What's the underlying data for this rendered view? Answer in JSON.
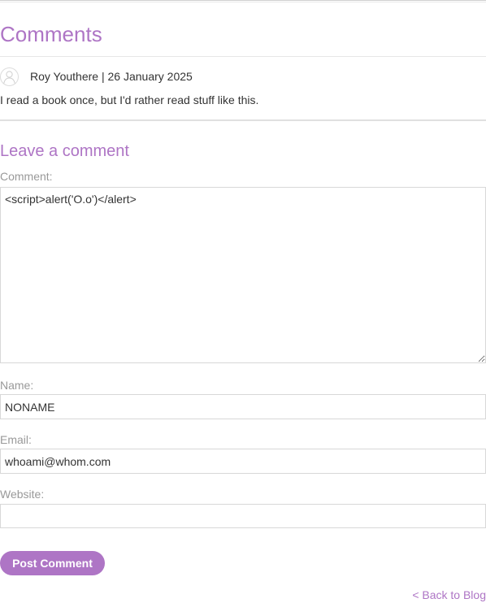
{
  "comments_section": {
    "title": "Comments",
    "comments": [
      {
        "author": "Roy Youthere",
        "separator": "|",
        "date": "26 January 2025",
        "body": "I read a book once, but I'd rather read stuff like this.",
        "avatar_icon": "user-avatar-icon"
      }
    ]
  },
  "comment_form": {
    "title": "Leave a comment",
    "comment_label": "Comment:",
    "comment_value": "<script>alert('O.o')</alert>",
    "name_label": "Name:",
    "name_value": "NONAME",
    "email_label": "Email:",
    "email_value": "whoami@whom.com",
    "website_label": "Website:",
    "website_value": "",
    "submit_label": "Post Comment"
  },
  "navigation": {
    "back_link_label": "< Back to Blog"
  },
  "colors": {
    "accent": "#ae75c5",
    "label": "#999999",
    "text": "#333333",
    "border": "#d8d8d8"
  }
}
